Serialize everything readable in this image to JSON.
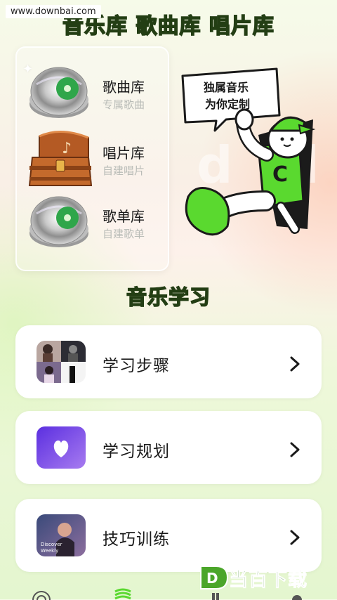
{
  "watermark_top": "www.downbai.com",
  "header": {
    "title": "音乐库 歌曲库 唱片库"
  },
  "libraries": [
    {
      "label": "歌曲库",
      "sub": "专属歌曲",
      "icon": "vinyl-disc-icon"
    },
    {
      "label": "唱片库",
      "sub": "自建唱片",
      "icon": "treasure-chest-icon"
    },
    {
      "label": "歌单库",
      "sub": "自建歌单",
      "icon": "vinyl-disc-icon"
    }
  ],
  "mascot": {
    "bubble_line1": "独属音乐",
    "bubble_line2": "为你定制",
    "shirt_letter": "C"
  },
  "section": {
    "title": "音乐学习"
  },
  "cards": [
    {
      "label": "学习步骤",
      "thumb_icon": "photo-collage-icon"
    },
    {
      "label": "学习规划",
      "thumb_icon": "heart-icon"
    },
    {
      "label": "技巧训练",
      "thumb_icon": "discover-weekly-cover-icon",
      "thumb_text_1": "Discover",
      "thumb_text_2": "Weekly"
    }
  ],
  "bottom_nav": [
    "record-icon",
    "wave-icon",
    "library-icon",
    "profile-icon"
  ],
  "watermark_bottom": {
    "logo_letter": "D",
    "text": "当百下载"
  },
  "colors": {
    "accent_green": "#5ad92f",
    "outline_dark": "#233e14",
    "purple": "#7d52e8"
  }
}
